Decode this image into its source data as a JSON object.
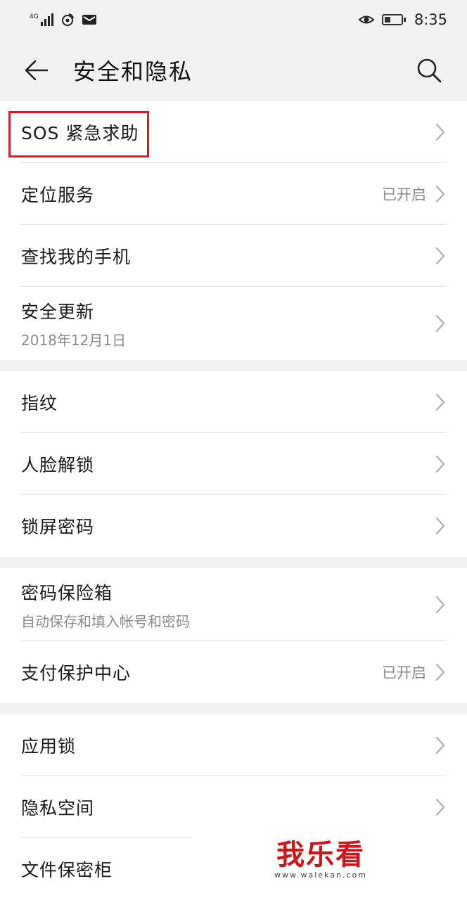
{
  "status_bar": {
    "network": "4G",
    "time": "8:35"
  },
  "header": {
    "title": "安全和隐私"
  },
  "groups": [
    {
      "items": [
        {
          "label": "SOS 紧急求助"
        },
        {
          "label": "定位服务",
          "value": "已开启"
        },
        {
          "label": "查找我的手机"
        },
        {
          "label": "安全更新",
          "sub": "2018年12月1日"
        }
      ]
    },
    {
      "items": [
        {
          "label": "指纹"
        },
        {
          "label": "人脸解锁"
        },
        {
          "label": "锁屏密码"
        }
      ]
    },
    {
      "items": [
        {
          "label": "密码保险箱",
          "sub": "自动保存和填入帐号和密码"
        },
        {
          "label": "支付保护中心",
          "value": "已开启"
        }
      ]
    },
    {
      "items": [
        {
          "label": "应用锁"
        },
        {
          "label": "隐私空间"
        },
        {
          "label": "文件保密柜"
        }
      ]
    }
  ],
  "watermark": {
    "title": "我乐看",
    "url": "www.walekan.com"
  },
  "colors": {
    "highlight": "#c8242d",
    "background": "#f2f2f2"
  }
}
